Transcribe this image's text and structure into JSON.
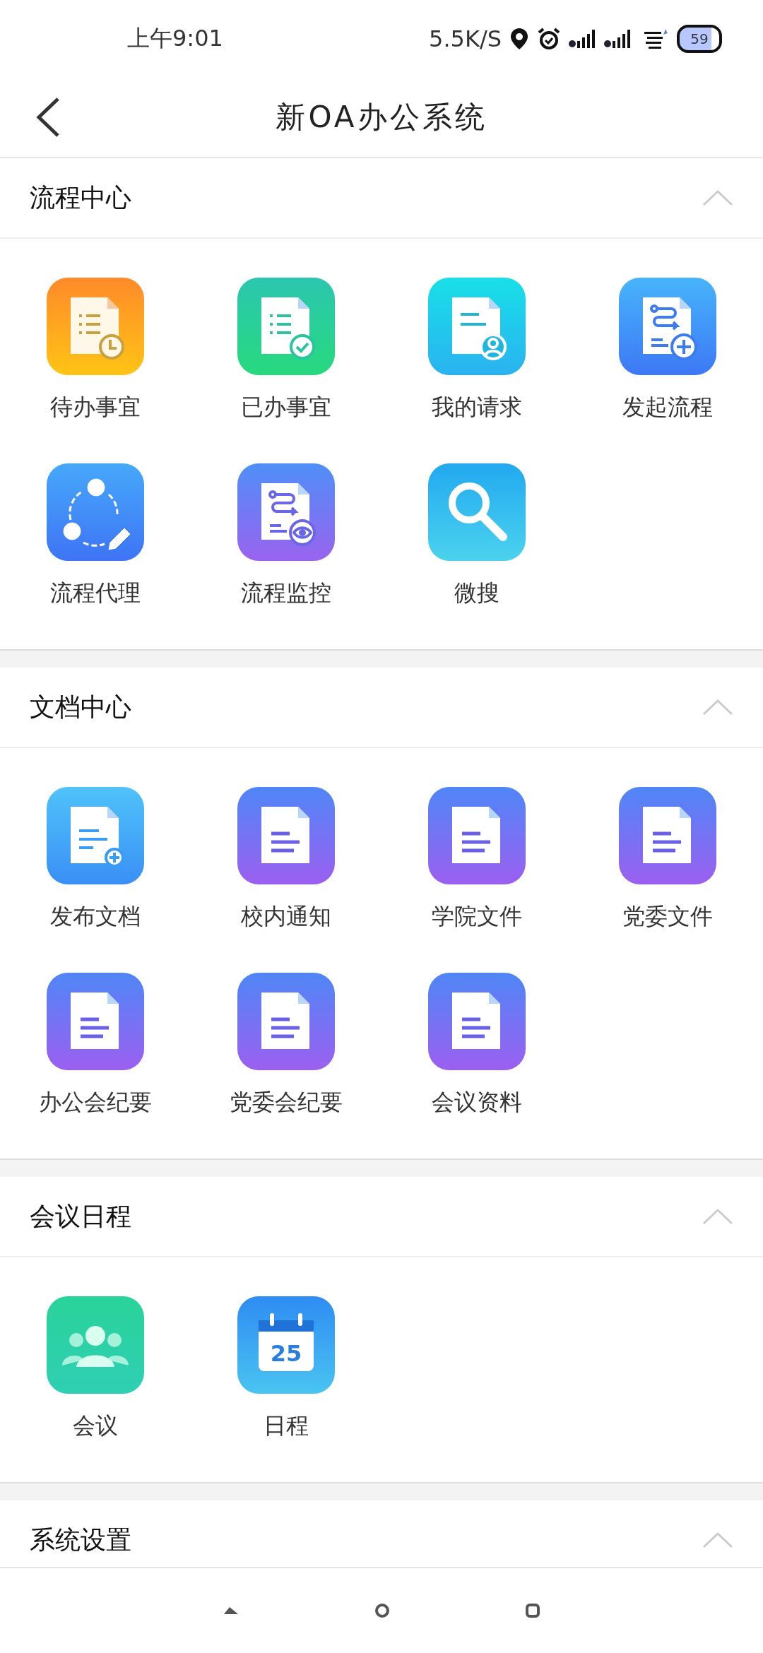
{
  "status_bar": {
    "time": "上午9:01",
    "net_speed": "5.5K/S",
    "battery": "59"
  },
  "header": {
    "title": "新OA办公系统"
  },
  "sections": [
    {
      "title": "流程中心",
      "expanded": true,
      "items": [
        {
          "label": "待办事宜",
          "kind": "pending"
        },
        {
          "label": "已办事宜",
          "kind": "done"
        },
        {
          "label": "我的请求",
          "kind": "request"
        },
        {
          "label": "发起流程",
          "kind": "start"
        },
        {
          "label": "流程代理",
          "kind": "delegate"
        },
        {
          "label": "流程监控",
          "kind": "monitor"
        },
        {
          "label": "微搜",
          "kind": "search"
        }
      ]
    },
    {
      "title": "文档中心",
      "expanded": true,
      "items": [
        {
          "label": "发布文档",
          "kind": "publish"
        },
        {
          "label": "校内通知",
          "kind": "document"
        },
        {
          "label": "学院文件",
          "kind": "document"
        },
        {
          "label": "党委文件",
          "kind": "document"
        },
        {
          "label": "办公会纪要",
          "kind": "document"
        },
        {
          "label": "党委会纪要",
          "kind": "document"
        },
        {
          "label": "会议资料",
          "kind": "document"
        }
      ]
    },
    {
      "title": "会议日程",
      "expanded": true,
      "items": [
        {
          "label": "会议",
          "kind": "meeting"
        },
        {
          "label": "日程",
          "kind": "calendar",
          "date": "25"
        }
      ]
    },
    {
      "title": "系统设置",
      "expanded": true
    }
  ]
}
